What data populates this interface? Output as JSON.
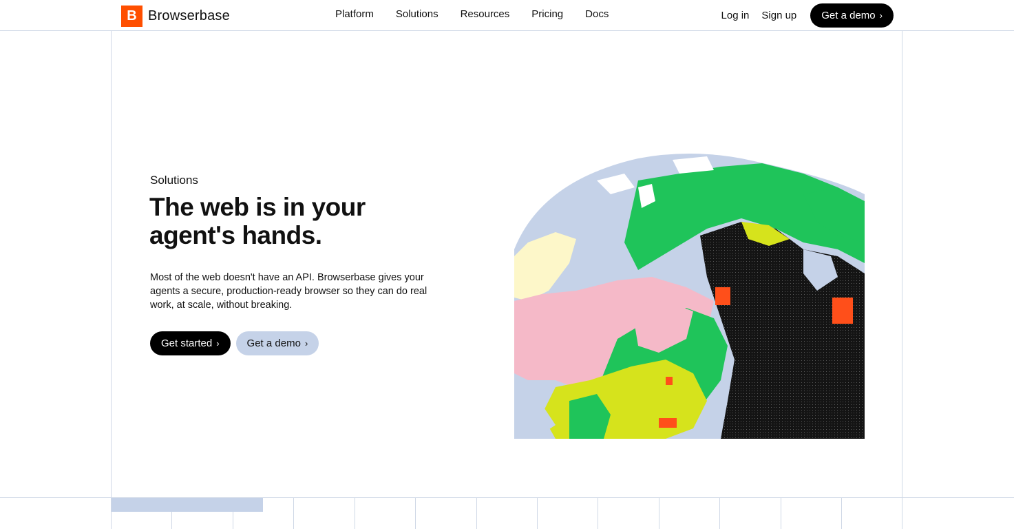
{
  "brand": {
    "name": "Browserbase",
    "logo_letter": "B",
    "accent_color": "#ff4f00"
  },
  "nav": {
    "links": [
      {
        "label": "Platform"
      },
      {
        "label": "Solutions"
      },
      {
        "label": "Resources"
      },
      {
        "label": "Pricing"
      },
      {
        "label": "Docs"
      }
    ],
    "login": "Log in",
    "signup": "Sign up",
    "cta": "Get a demo",
    "cta_icon": "chevron-right-icon"
  },
  "hero": {
    "eyebrow": "Solutions",
    "headline_line1": "The web is in your",
    "headline_line2": "agent's hands.",
    "body": "Most of the web doesn't have an API. Browserbase gives your agents a secure, production-ready browser so they can do real work, at scale, without breaking.",
    "primary_cta": "Get started",
    "secondary_cta": "Get a demo",
    "image": "pixelated-globe-illustration"
  },
  "colors": {
    "frame_line": "#cfd8e6",
    "button_dark": "#000000",
    "button_light": "#c5d2e8",
    "globe_ocean": "#c5d2e8",
    "globe_green": "#1fc45a",
    "globe_pink": "#f5b9c8",
    "globe_yellow": "#d6e31c",
    "globe_cream": "#fdf7c9",
    "globe_black": "#141414",
    "globe_orange": "#ff4f1a"
  }
}
